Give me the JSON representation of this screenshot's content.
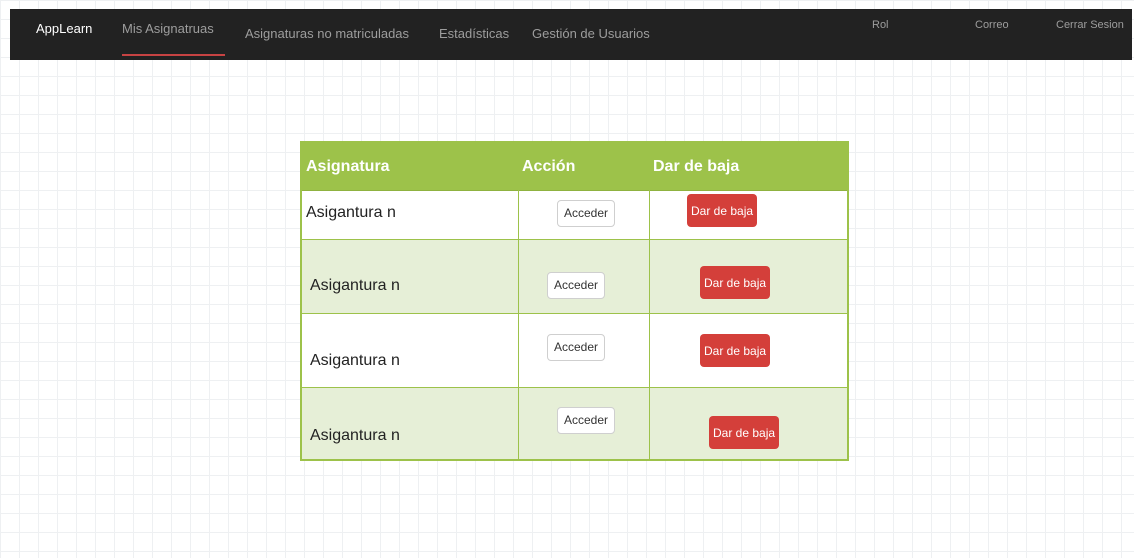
{
  "navbar": {
    "brand": "AppLearn",
    "links": [
      "Mis Asignatruas",
      "Asignaturas no matriculadas",
      "Estadísticas",
      "Gestión de Usuarios"
    ],
    "right": [
      "Rol",
      "Correo",
      "Cerrar Sesion"
    ],
    "active_index": 0
  },
  "table": {
    "headers": [
      "Asignatura",
      "Acción",
      "Dar de baja"
    ],
    "rows": [
      {
        "subject": "Asigantura n",
        "access_label": "Acceder",
        "drop_label": "Dar de baja"
      },
      {
        "subject": "Asigantura n",
        "access_label": "Acceder",
        "drop_label": "Dar de baja"
      },
      {
        "subject": "Asigantura n",
        "access_label": "Acceder",
        "drop_label": "Dar de baja"
      },
      {
        "subject": "Asigantura n",
        "access_label": "Acceder",
        "drop_label": "Dar de baja"
      }
    ]
  },
  "colors": {
    "navbar": "#222222",
    "header_green": "#9dc24a",
    "row_alt": "#e6efd7",
    "danger": "#d43f3a",
    "active_underline": "#c74343"
  }
}
